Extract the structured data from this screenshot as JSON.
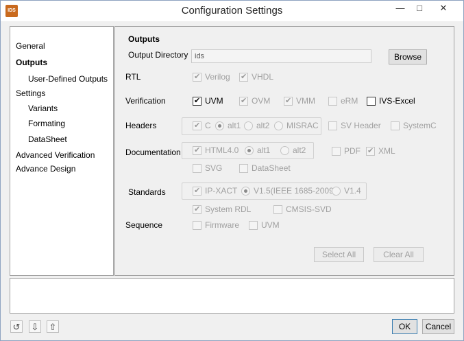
{
  "window": {
    "title": "Configuration Settings",
    "app_icon_text": "IDS",
    "icons": {
      "minimize": "minimize-icon",
      "maximize": "maximize-icon",
      "close": "close-icon"
    }
  },
  "nav": {
    "items": [
      {
        "label": "General"
      },
      {
        "label": "Outputs"
      },
      {
        "label": "User-Defined Outputs"
      },
      {
        "label": "Settings"
      },
      {
        "label": "Variants"
      },
      {
        "label": "Formating"
      },
      {
        "label": "DataSheet"
      },
      {
        "label": "Advanced Verification"
      },
      {
        "label": "Advance Design"
      }
    ],
    "selected": "Outputs"
  },
  "outputs": {
    "section_title": "Outputs",
    "output_directory_label": "Output Directory",
    "output_directory_value": "ids",
    "browse_label": "Browse",
    "rtl": {
      "label": "RTL",
      "options": [
        {
          "label": "Verilog",
          "checked": true
        },
        {
          "label": "VHDL",
          "checked": true
        }
      ]
    },
    "verification": {
      "label": "Verification",
      "options": [
        {
          "label": "UVM",
          "checked": true
        },
        {
          "label": "OVM",
          "checked": true
        },
        {
          "label": "VMM",
          "checked": true
        },
        {
          "label": "eRM",
          "checked": false
        },
        {
          "label": "IVS-Excel",
          "checked": false
        }
      ]
    },
    "headers": {
      "label": "Headers",
      "c_label": "C",
      "radios": [
        {
          "label": "alt1",
          "checked": true
        },
        {
          "label": "alt2",
          "checked": false
        },
        {
          "label": "MISRAC",
          "checked": false
        }
      ],
      "sv_header_label": "SV Header",
      "systemc_label": "SystemC"
    },
    "documentation": {
      "label": "Documentation",
      "html_label": "HTML4.0",
      "radios": [
        {
          "label": "alt1",
          "checked": true
        },
        {
          "label": "alt2",
          "checked": false
        }
      ],
      "pdf_label": "PDF",
      "xml_label": "XML",
      "svg_label": "SVG",
      "datasheet_label": "DataSheet"
    },
    "standards": {
      "label": "Standards",
      "ipxact_label": "IP-XACT",
      "radios": [
        {
          "label": "V1.5(IEEE 1685-2009)",
          "checked": true
        },
        {
          "label": "V1.4",
          "checked": false
        }
      ],
      "system_rdl_label": "System RDL",
      "cmsis_label": "CMSIS-SVD"
    },
    "sequence": {
      "label": "Sequence",
      "firmware_label": "Firmware",
      "uvm_label": "UVM"
    },
    "select_all_label": "Select All",
    "clear_all_label": "Clear All"
  },
  "footer": {
    "ok_label": "OK",
    "cancel_label": "Cancel",
    "tools": [
      "reset-icon",
      "import-icon",
      "export-icon"
    ]
  }
}
